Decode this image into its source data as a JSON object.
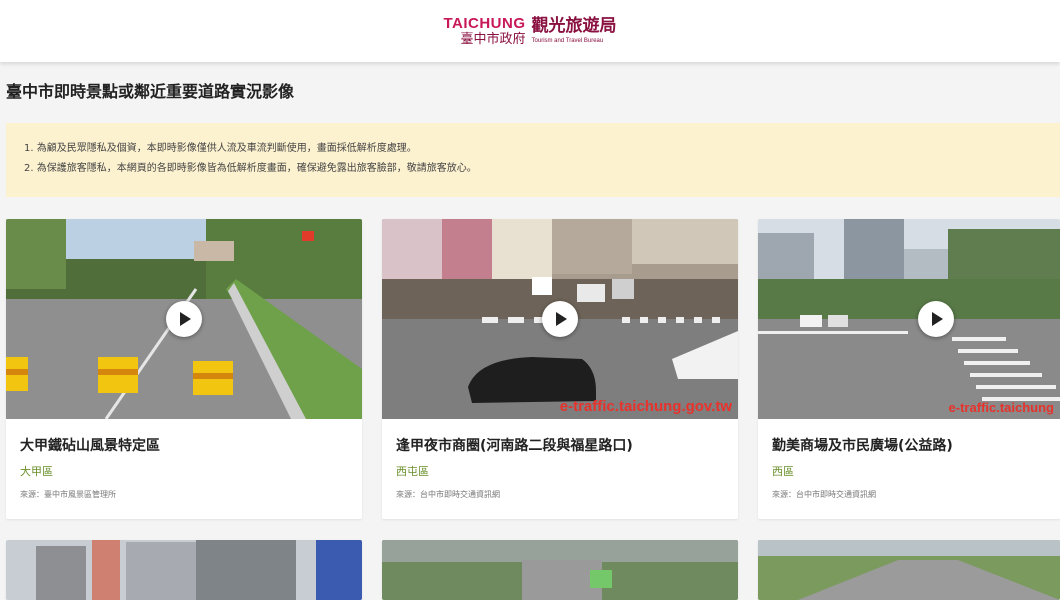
{
  "header": {
    "logo_en": "TAICHUNG",
    "logo_gov": "臺中市政府",
    "logo_bureau": "觀光旅遊局",
    "logo_bureau_en": "Tourism and Travel Bureau"
  },
  "page_title": "臺中市即時景點或鄰近重要道路實況影像",
  "notices": [
    "1. 為顧及民眾隱私及個資，本即時影像僅供人流及車流判斷使用，畫面採低解析度處理。",
    "2. 為保護旅客隱私，本網頁的各即時影像皆為低解析度畫面，確保避免露出旅客臉部，敬請旅客放心。"
  ],
  "cameras": [
    {
      "title": "大甲鐵砧山風景特定區",
      "district": "大甲區",
      "source": "來源：臺中市風景區管理所",
      "watermark": ""
    },
    {
      "title": "逢甲夜市商圈(河南路二段與福星路口)",
      "district": "西屯區",
      "source": "來源：台中市即時交通資訊網",
      "watermark": "e-traffic.taichung.gov.tw"
    },
    {
      "title": "勤美商場及市民廣場(公益路)",
      "district": "西區",
      "source": "來源：台中市即時交通資訊網",
      "watermark": "e-traffic.taichung"
    }
  ],
  "colors": {
    "brand": "#c8185a",
    "district": "#6a8f2a",
    "notice_bg": "#fdf2d0"
  }
}
